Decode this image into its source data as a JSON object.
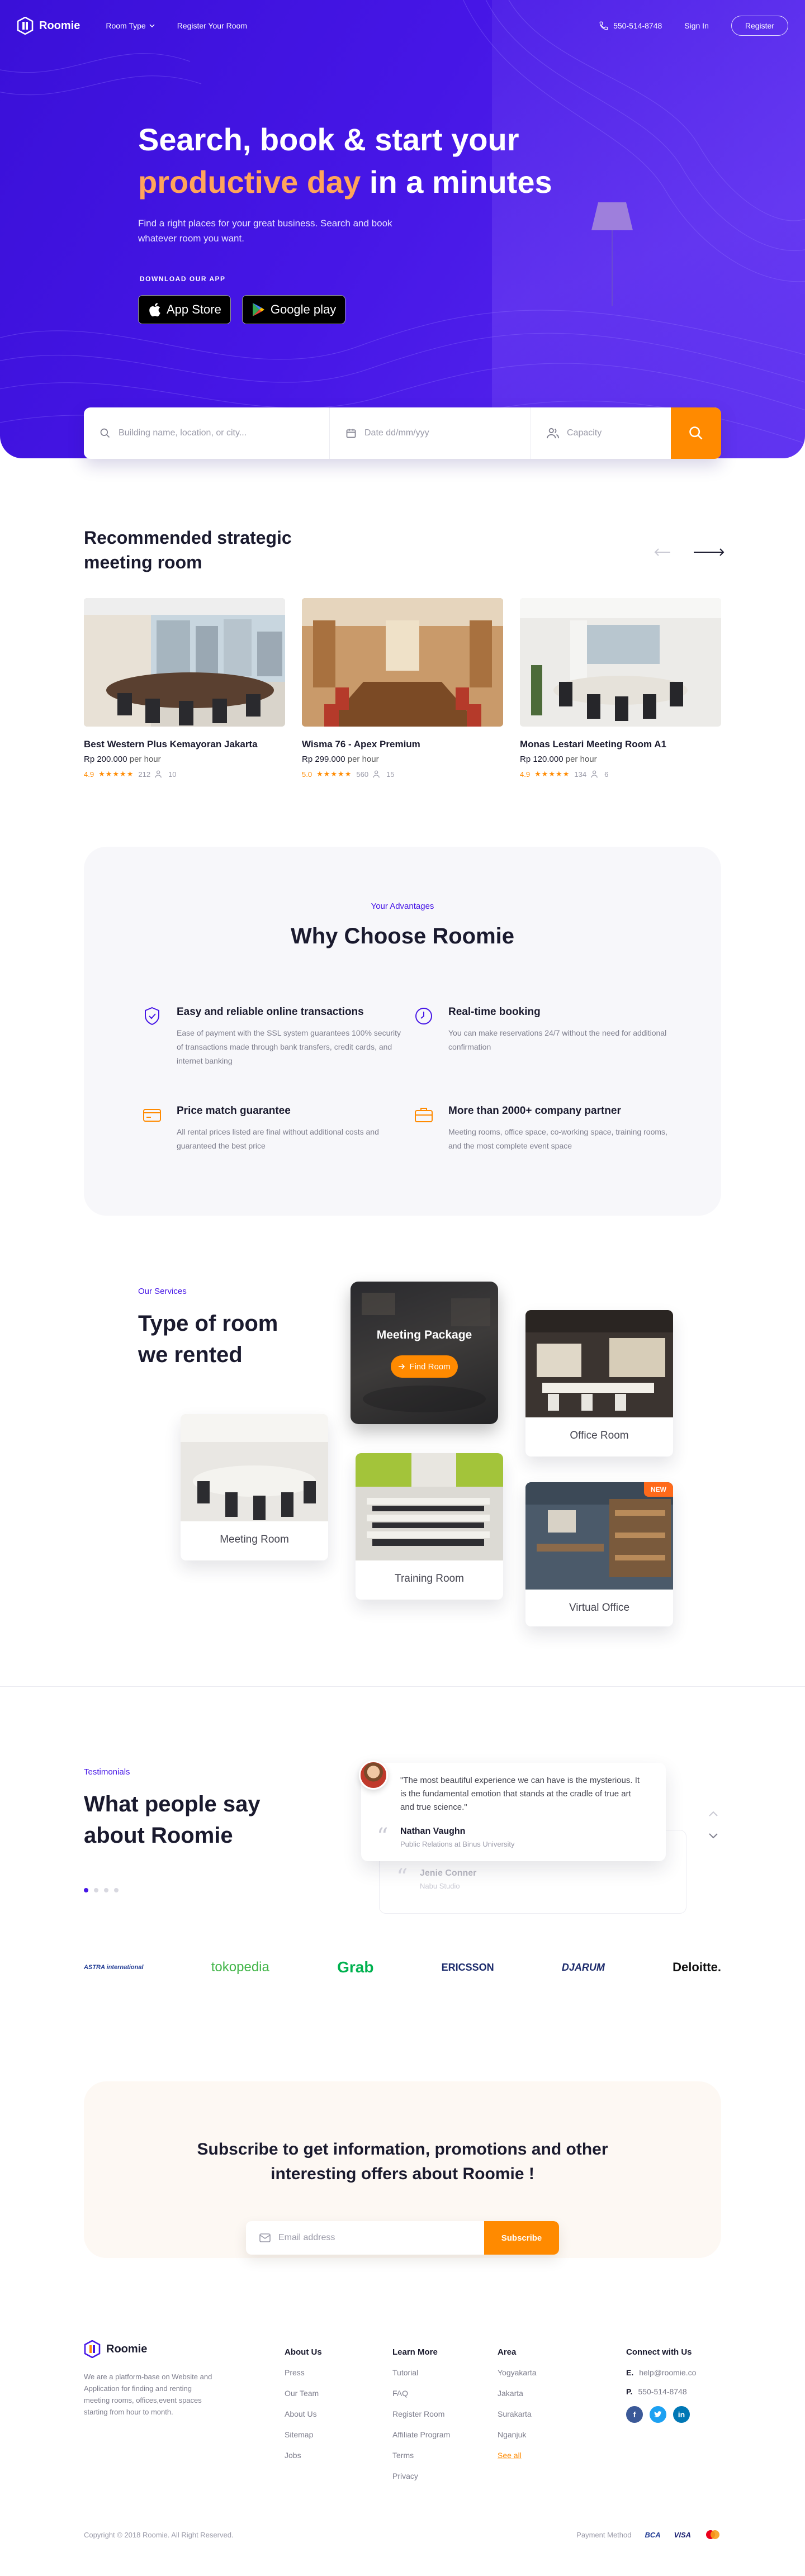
{
  "nav": {
    "brand": "Roomie",
    "links": [
      "Room Type",
      "Register Your Room"
    ],
    "phone": "550-514-8748",
    "signin": "Sign In",
    "register": "Register"
  },
  "hero": {
    "title_line1": "Search, book & start your",
    "title_accent": "productive day",
    "title_rest": " in a minutes",
    "subtitle": "Find a right places for your great business. Search and book whatever room you want.",
    "download_label": "DOWNLOAD OUR APP",
    "app_store": "App Store",
    "google_play": "Google play"
  },
  "search": {
    "location_placeholder": "Building name, location, or city...",
    "date_placeholder": "Date dd/mm/yyy",
    "capacity_placeholder": "Capacity"
  },
  "recommended": {
    "title": "Recommended strategic meeting room",
    "rooms": [
      {
        "name": "Best Western Plus Kemayoran Jakarta",
        "price": "Rp 200.000",
        "unit": " per hour",
        "rating": "4.9",
        "stars": "★★★★★",
        "reviews": "212",
        "capacity": "10"
      },
      {
        "name": "Wisma 76 - Apex Premium",
        "price": "Rp 299.000",
        "unit": " per hour",
        "rating": "5.0",
        "stars": "★★★★★",
        "reviews": "560",
        "capacity": "15"
      },
      {
        "name": "Monas Lestari Meeting Room A1",
        "price": "Rp 120.000",
        "unit": " per hour",
        "rating": "4.9",
        "stars": "★★★★★",
        "reviews": "134",
        "capacity": "6"
      }
    ]
  },
  "why": {
    "tag": "Your Advantages",
    "title": "Why Choose Roomie",
    "items": [
      {
        "title": "Easy and reliable online transactions",
        "text": "Ease of payment with the SSL system guarantees 100% security of transactions made through bank transfers, credit cards, and internet banking"
      },
      {
        "title": "Real-time booking",
        "text": "You can make reservations 24/7 without the need for additional confirmation"
      },
      {
        "title": "Price match guarantee",
        "text": "All rental prices listed are final without additional costs and guaranteed the best price"
      },
      {
        "title": "More than 2000+ company partner",
        "text": "Meeting rooms, office space, co-working space, training rooms, and the most complete event space"
      }
    ]
  },
  "services": {
    "tag": "Our Services",
    "title": "Type of room we rented",
    "package_title": "Meeting Package",
    "package_button": "Find Room",
    "rooms": [
      "Office Room",
      "Meeting Room",
      "Training Room",
      "Virtual Office"
    ],
    "new_badge": "NEW"
  },
  "testimonials": {
    "tag": "Testimonials",
    "title": "What people say about Roomie",
    "quote": "\"The most beautiful experience we can have is the mysterious. It is the fundamental emotion that stands at the cradle of true art and true science.\"",
    "name": "Nathan Vaughn",
    "role": "Public Relations at Binus University",
    "name2": "Jenie Conner",
    "role2": "Nabu Studio"
  },
  "partners": [
    "ASTRA international",
    "tokopedia",
    "Grab",
    "ERICSSON",
    "DJARUM",
    "Deloitte."
  ],
  "subscribe": {
    "title": "Subscribe to get information, promotions and other interesting offers about Roomie !",
    "placeholder": "Email address",
    "button": "Subscribe"
  },
  "footer": {
    "brand": "Roomie",
    "description": "We are a platform-base on Website and Application for finding and renting meeting rooms, offices,event spaces starting from hour to month.",
    "about": {
      "title": "About Us",
      "links": [
        "Press",
        "Our Team",
        "About Us",
        "Sitemap",
        "Jobs"
      ]
    },
    "learn": {
      "title": "Learn More",
      "links": [
        "Tutorial",
        "FAQ",
        "Register Room",
        "Affiliate Program",
        "Terms",
        "Privacy"
      ]
    },
    "area": {
      "title": "Area",
      "links": [
        "Yogyakarta",
        "Jakarta",
        "Surakarta",
        "Nganjuk"
      ],
      "see_all": "See all"
    },
    "connect": {
      "title": "Connect with Us",
      "email_prefix": "E.",
      "email": "help@roomie.co",
      "phone_prefix": "P.",
      "phone": "550-514-8748"
    },
    "copyright": "Copyright © 2018 Roomie. All Right Reserved.",
    "payment_label": "Payment Method",
    "payments": [
      "BCA",
      "VISA"
    ]
  },
  "colors": {
    "primary": "#4616e6",
    "accent": "#ff8a00",
    "hero_accent_text": "#ffa45b"
  }
}
